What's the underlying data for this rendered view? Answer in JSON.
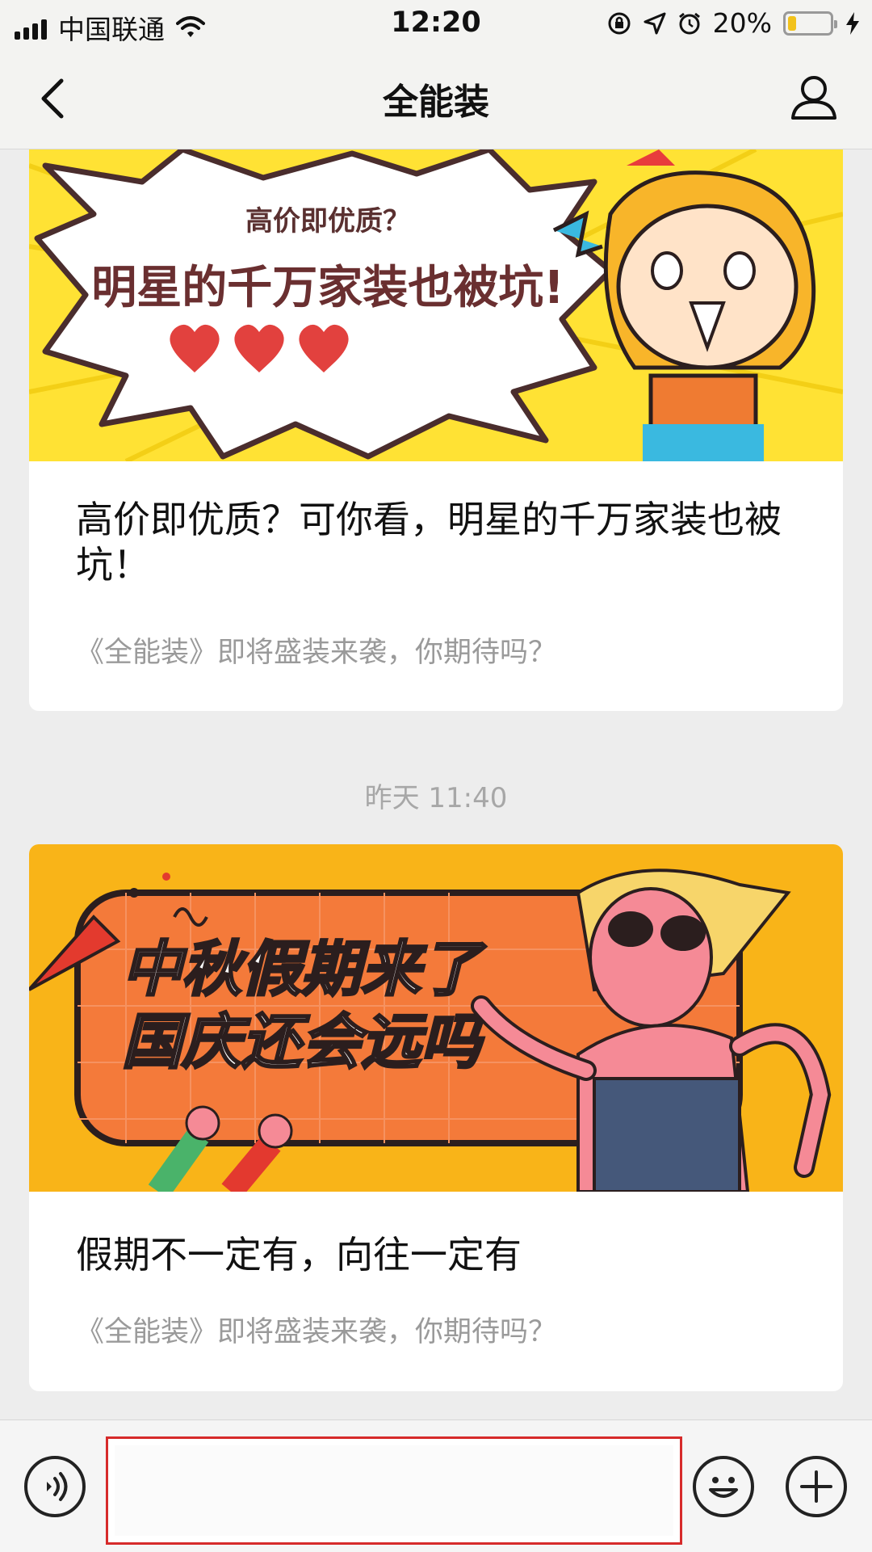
{
  "status_bar": {
    "carrier": "中国联通",
    "time": "12:20",
    "battery": "20%",
    "battery_level": 0.2,
    "icons": [
      "signal-icon",
      "wifi-icon",
      "rotation-lock-icon",
      "location-icon",
      "alarm-icon",
      "battery-icon",
      "charging-icon"
    ]
  },
  "nav": {
    "title": "全能装",
    "back_icon": "chevron-left-icon",
    "profile_icon": "person-icon"
  },
  "messages": [
    {
      "banner": {
        "small_text": "高价即优质？",
        "big_text": "明星的千万家装也被坑!"
      },
      "title": "高价即优质？可你看，明星的千万家装也被坑！",
      "subtitle": "《全能装》即将盛装来袭，你期待吗？"
    },
    {
      "banner": {
        "line1": "中秋假期来了",
        "line2": "国庆还会远吗"
      },
      "title": "假期不一定有，向往一定有",
      "subtitle": "《全能装》即将盛装来袭，你期待吗？"
    }
  ],
  "timestamp": "昨天 11:40",
  "input_bar": {
    "voice_icon": "voice-icon",
    "emoji_icon": "emoji-icon",
    "plus_icon": "plus-icon",
    "input_value": "",
    "input_placeholder": ""
  },
  "colors": {
    "background": "#ededed",
    "bar": "#f3f3f1",
    "banner1_bg": "#ffe234",
    "banner2_bg": "#f9b418",
    "banner2_panel": "#f47a3a",
    "highlight_border": "#d62a2a",
    "subtitle": "#9a9a9a"
  }
}
